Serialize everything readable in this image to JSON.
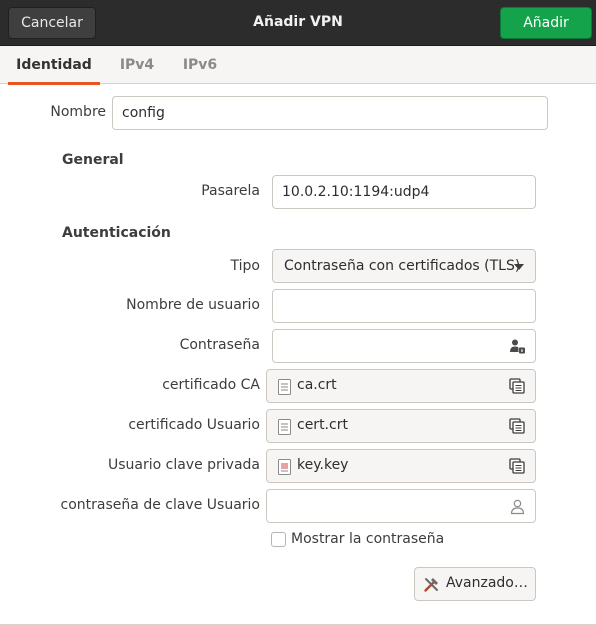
{
  "dialog": {
    "title": "Añadir VPN",
    "cancel_label": "Cancelar",
    "add_label": "Añadir"
  },
  "tabs": [
    {
      "label": "Identidad",
      "active": true
    },
    {
      "label": "IPv4",
      "active": false
    },
    {
      "label": "IPv6",
      "active": false
    }
  ],
  "identity": {
    "name_label": "Nombre",
    "name_value": "config"
  },
  "general": {
    "heading": "General",
    "gateway_label": "Pasarela",
    "gateway_value": "10.0.2.10:1194:udp4"
  },
  "auth": {
    "heading": "Autenticación",
    "type_label": "Tipo",
    "type_value": "Contraseña con certificados (TLS)",
    "username_label": "Nombre de usuario",
    "username_value": "",
    "password_label": "Contraseña",
    "password_value": "",
    "ca_label": "certificado CA",
    "ca_file": "ca.crt",
    "user_cert_label": "certificado Usuario",
    "user_cert_file": "cert.crt",
    "private_key_label": "Usuario clave privada",
    "private_key_file": "key.key",
    "key_password_label": "contraseña de clave Usuario",
    "key_password_value": "",
    "show_password_label": "Mostrar la contraseña",
    "show_password_checked": false,
    "advanced_label": "Avanzado…"
  },
  "icons": {
    "password_owner": "user-lock-icon",
    "file_doc": "document-icon",
    "file_picker": "file-chooser-icon",
    "key_password_owner": "user-icon",
    "advanced": "tools-icon",
    "type_dropdown": "chevron-down-icon"
  },
  "colors": {
    "headerbar": "#2c2c2c",
    "add_button": "#14a34a",
    "active_tab_underline": "#e95420"
  }
}
